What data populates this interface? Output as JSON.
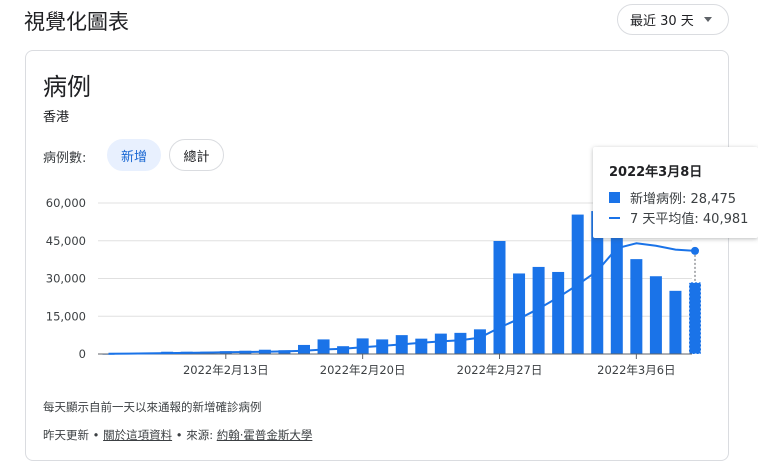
{
  "header": {
    "title": "視覺化圖表",
    "range_label": "最近 30 天"
  },
  "card": {
    "title": "病例",
    "region": "香港",
    "metric_label": "病例數:",
    "chips": [
      {
        "label": "新增",
        "selected": true
      },
      {
        "label": "總計",
        "selected": false
      }
    ]
  },
  "tooltip": {
    "date": "2022年3月8日",
    "bar_label": "新增病例: 28,475",
    "line_label": "7 天平均值: 40,981"
  },
  "footer": {
    "note": "每天顯示自前一天以來通報的新增確診病例",
    "updated": "昨天更新 • ",
    "about_link": "關於這項資料",
    "source_prefix": " • 來源: ",
    "source_link": "約翰·霍普金斯大學"
  },
  "colors": {
    "bar": "#1a73e8",
    "line": "#1a73e8",
    "axis": "#5f6368",
    "grid": "#e0e0e0"
  },
  "chart_data": {
    "type": "bar",
    "series": [
      {
        "name": "新增病例",
        "type": "bar",
        "values": [
          50,
          200,
          600,
          900,
          900,
          900,
          1100,
          1300,
          1700,
          1500,
          3600,
          5800,
          3100,
          6200,
          5800,
          7500,
          6100,
          8100,
          8400,
          9800,
          44900,
          32000,
          34600,
          32600,
          55400,
          56800,
          52500,
          37700,
          30900,
          25100,
          28475
        ]
      },
      {
        "name": "7 天平均值",
        "type": "line",
        "values": [
          80,
          150,
          250,
          350,
          450,
          550,
          700,
          800,
          900,
          1050,
          1300,
          1800,
          2100,
          2700,
          3200,
          3800,
          4500,
          5000,
          5500,
          6500,
          10500,
          14000,
          18000,
          22500,
          27500,
          33000,
          42000,
          44000,
          43000,
          41500,
          40981
        ]
      }
    ],
    "x_tick_labels": [
      "2022年2月13日",
      "2022年2月20日",
      "2022年2月27日",
      "2022年3月6日"
    ],
    "y_ticks": [
      0,
      15000,
      30000,
      45000,
      60000
    ],
    "y_tick_labels": [
      "0",
      "15,000",
      "30,000",
      "45,000",
      "60,000"
    ],
    "ylim": [
      0,
      60000
    ],
    "highlighted_point": {
      "date": "2022年3月8日",
      "bar": 28475,
      "avg": 40981
    }
  }
}
